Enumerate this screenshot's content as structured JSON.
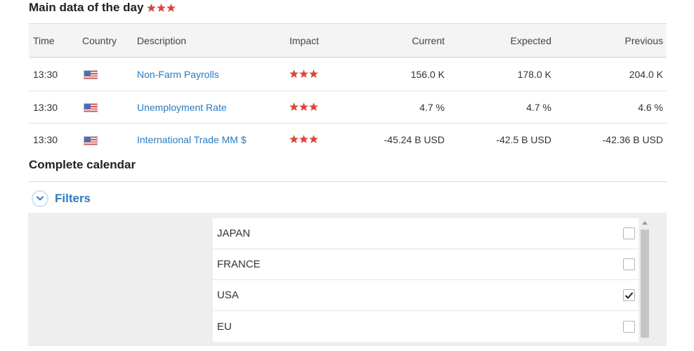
{
  "main": {
    "title": "Main data of the day",
    "title_stars": 3,
    "headers": {
      "time": "Time",
      "country": "Country",
      "description": "Description",
      "impact": "Impact",
      "current": "Current",
      "expected": "Expected",
      "previous": "Previous"
    },
    "rows": [
      {
        "time": "13:30",
        "country_icon": "usa-flag-icon",
        "description": "Non-Farm Payrolls",
        "impact_stars": 3,
        "current": "156.0 K",
        "expected": "178.0 K",
        "previous": "204.0 K"
      },
      {
        "time": "13:30",
        "country_icon": "usa-flag-icon",
        "description": "Unemployment Rate",
        "impact_stars": 3,
        "current": "4.7 %",
        "expected": "4.7 %",
        "previous": "4.6 %"
      },
      {
        "time": "13:30",
        "country_icon": "usa-flag-icon",
        "description": "International Trade MM $",
        "impact_stars": 3,
        "current": "-45.24 B USD",
        "expected": "-42.5 B USD",
        "previous": "-42.36 B USD"
      }
    ]
  },
  "calendar": {
    "title": "Complete calendar",
    "filters_label": "Filters",
    "filters_icon": "chevron-down-icon",
    "countries": [
      {
        "label": "JAPAN",
        "checked": false
      },
      {
        "label": "FRANCE",
        "checked": false
      },
      {
        "label": "USA",
        "checked": true
      },
      {
        "label": "EU",
        "checked": false
      }
    ]
  },
  "colors": {
    "star": "#d9463a",
    "link": "#2b7bbf",
    "header_bg": "#f4f4f4",
    "panel_bg": "#eeeeee"
  }
}
